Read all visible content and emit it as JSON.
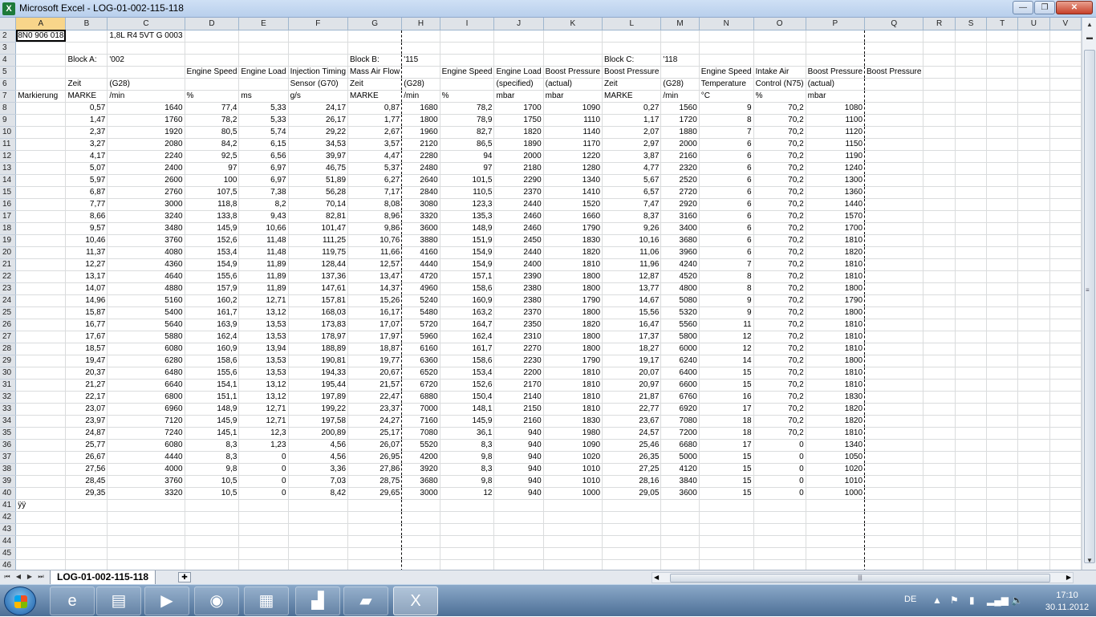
{
  "window": {
    "title": "Microsoft Excel - LOG-01-002-115-118",
    "app_icon": "X",
    "min_label": "—",
    "max_label": "❐",
    "close_label": "✕"
  },
  "columns": [
    "A",
    "B",
    "C",
    "D",
    "E",
    "F",
    "G",
    "H",
    "I",
    "J",
    "K",
    "L",
    "M",
    "N",
    "O",
    "P",
    "Q",
    "R",
    "S",
    "T",
    "U",
    "V"
  ],
  "rows": [
    {
      "n": "2",
      "c": [
        "8N0 906 018",
        "",
        "1,8L R4 5VT   G  0003",
        "",
        "",
        "",
        "",
        "",
        "",
        "",
        "",
        "",
        "",
        "",
        "",
        "",
        "",
        "",
        "",
        "",
        "",
        ""
      ]
    },
    {
      "n": "3",
      "c": [
        "",
        "",
        "",
        "",
        "",
        "",
        "",
        "",
        "",
        "",
        "",
        "",
        "",
        "",
        "",
        "",
        "",
        "",
        "",
        "",
        "",
        ""
      ]
    },
    {
      "n": "4",
      "c": [
        "",
        "Block A:",
        "'002",
        "",
        "",
        "",
        "Block B:",
        "'115",
        "",
        "",
        "",
        "Block C:",
        "'118",
        "",
        "",
        "",
        "",
        "",
        "",
        "",
        "",
        ""
      ]
    },
    {
      "n": "5",
      "c": [
        "",
        "",
        "",
        "Engine Speed",
        "Engine Load",
        "Injection Timing",
        "Mass Air Flow",
        "",
        "Engine Speed",
        "Engine Load",
        "Boost Pressure",
        "Boost Pressure",
        "",
        "Engine Speed",
        "Intake Air",
        "Boost Pressure",
        "Boost Pressure",
        "",
        "",
        "",
        "",
        ""
      ]
    },
    {
      "n": "6",
      "c": [
        "",
        "Zeit",
        "(G28)",
        "",
        "",
        "Sensor (G70)",
        "Zeit",
        "(G28)",
        "",
        "(specified)",
        "(actual)",
        "Zeit",
        "(G28)",
        "Temperature",
        "Control (N75)",
        "(actual)",
        "",
        "",
        "",
        "",
        "",
        ""
      ]
    },
    {
      "n": "7",
      "c": [
        "Markierung",
        "MARKE",
        "/min",
        "%",
        "ms",
        "g/s",
        "MARKE",
        "/min",
        "%",
        "mbar",
        "mbar",
        "MARKE",
        "/min",
        "°C",
        "%",
        "mbar",
        "",
        "",
        "",
        "",
        "",
        ""
      ]
    },
    {
      "n": "8",
      "c": [
        "",
        "0,57",
        "1640",
        "77,4",
        "5,33",
        "24,17",
        "0,87",
        "1680",
        "78,2",
        "1700",
        "1090",
        "0,27",
        "1560",
        "9",
        "70,2",
        "1080",
        "",
        "",
        "",
        "",
        "",
        ""
      ]
    },
    {
      "n": "9",
      "c": [
        "",
        "1,47",
        "1760",
        "78,2",
        "5,33",
        "26,17",
        "1,77",
        "1800",
        "78,9",
        "1750",
        "1110",
        "1,17",
        "1720",
        "8",
        "70,2",
        "1100",
        "",
        "",
        "",
        "",
        "",
        ""
      ]
    },
    {
      "n": "10",
      "c": [
        "",
        "2,37",
        "1920",
        "80,5",
        "5,74",
        "29,22",
        "2,67",
        "1960",
        "82,7",
        "1820",
        "1140",
        "2,07",
        "1880",
        "7",
        "70,2",
        "1120",
        "",
        "",
        "",
        "",
        "",
        ""
      ]
    },
    {
      "n": "11",
      "c": [
        "",
        "3,27",
        "2080",
        "84,2",
        "6,15",
        "34,53",
        "3,57",
        "2120",
        "86,5",
        "1890",
        "1170",
        "2,97",
        "2000",
        "6",
        "70,2",
        "1150",
        "",
        "",
        "",
        "",
        "",
        ""
      ]
    },
    {
      "n": "12",
      "c": [
        "",
        "4,17",
        "2240",
        "92,5",
        "6,56",
        "39,97",
        "4,47",
        "2280",
        "94",
        "2000",
        "1220",
        "3,87",
        "2160",
        "6",
        "70,2",
        "1190",
        "",
        "",
        "",
        "",
        "",
        ""
      ]
    },
    {
      "n": "13",
      "c": [
        "",
        "5,07",
        "2400",
        "97",
        "6,97",
        "46,75",
        "5,37",
        "2480",
        "97",
        "2180",
        "1280",
        "4,77",
        "2320",
        "6",
        "70,2",
        "1240",
        "",
        "",
        "",
        "",
        "",
        ""
      ]
    },
    {
      "n": "14",
      "c": [
        "",
        "5,97",
        "2600",
        "100",
        "6,97",
        "51,89",
        "6,27",
        "2640",
        "101,5",
        "2290",
        "1340",
        "5,67",
        "2520",
        "6",
        "70,2",
        "1300",
        "",
        "",
        "",
        "",
        "",
        ""
      ]
    },
    {
      "n": "15",
      "c": [
        "",
        "6,87",
        "2760",
        "107,5",
        "7,38",
        "56,28",
        "7,17",
        "2840",
        "110,5",
        "2370",
        "1410",
        "6,57",
        "2720",
        "6",
        "70,2",
        "1360",
        "",
        "",
        "",
        "",
        "",
        ""
      ]
    },
    {
      "n": "16",
      "c": [
        "",
        "7,77",
        "3000",
        "118,8",
        "8,2",
        "70,14",
        "8,08",
        "3080",
        "123,3",
        "2440",
        "1520",
        "7,47",
        "2920",
        "6",
        "70,2",
        "1440",
        "",
        "",
        "",
        "",
        "",
        ""
      ]
    },
    {
      "n": "17",
      "c": [
        "",
        "8,66",
        "3240",
        "133,8",
        "9,43",
        "82,81",
        "8,96",
        "3320",
        "135,3",
        "2460",
        "1660",
        "8,37",
        "3160",
        "6",
        "70,2",
        "1570",
        "",
        "",
        "",
        "",
        "",
        ""
      ]
    },
    {
      "n": "18",
      "c": [
        "",
        "9,57",
        "3480",
        "145,9",
        "10,66",
        "101,47",
        "9,86",
        "3600",
        "148,9",
        "2460",
        "1790",
        "9,26",
        "3400",
        "6",
        "70,2",
        "1700",
        "",
        "",
        "",
        "",
        "",
        ""
      ]
    },
    {
      "n": "19",
      "c": [
        "",
        "10,46",
        "3760",
        "152,6",
        "11,48",
        "111,25",
        "10,76",
        "3880",
        "151,9",
        "2450",
        "1830",
        "10,16",
        "3680",
        "6",
        "70,2",
        "1810",
        "",
        "",
        "",
        "",
        "",
        ""
      ]
    },
    {
      "n": "20",
      "c": [
        "",
        "11,37",
        "4080",
        "153,4",
        "11,48",
        "119,75",
        "11,66",
        "4160",
        "154,9",
        "2440",
        "1820",
        "11,06",
        "3960",
        "6",
        "70,2",
        "1820",
        "",
        "",
        "",
        "",
        "",
        ""
      ]
    },
    {
      "n": "21",
      "c": [
        "",
        "12,27",
        "4360",
        "154,9",
        "11,89",
        "128,44",
        "12,57",
        "4440",
        "154,9",
        "2400",
        "1810",
        "11,96",
        "4240",
        "7",
        "70,2",
        "1810",
        "",
        "",
        "",
        "",
        "",
        ""
      ]
    },
    {
      "n": "22",
      "c": [
        "",
        "13,17",
        "4640",
        "155,6",
        "11,89",
        "137,36",
        "13,47",
        "4720",
        "157,1",
        "2390",
        "1800",
        "12,87",
        "4520",
        "8",
        "70,2",
        "1810",
        "",
        "",
        "",
        "",
        "",
        ""
      ]
    },
    {
      "n": "23",
      "c": [
        "",
        "14,07",
        "4880",
        "157,9",
        "11,89",
        "147,61",
        "14,37",
        "4960",
        "158,6",
        "2380",
        "1800",
        "13,77",
        "4800",
        "8",
        "70,2",
        "1800",
        "",
        "",
        "",
        "",
        "",
        ""
      ]
    },
    {
      "n": "24",
      "c": [
        "",
        "14,96",
        "5160",
        "160,2",
        "12,71",
        "157,81",
        "15,26",
        "5240",
        "160,9",
        "2380",
        "1790",
        "14,67",
        "5080",
        "9",
        "70,2",
        "1790",
        "",
        "",
        "",
        "",
        "",
        ""
      ]
    },
    {
      "n": "25",
      "c": [
        "",
        "15,87",
        "5400",
        "161,7",
        "13,12",
        "168,03",
        "16,17",
        "5480",
        "163,2",
        "2370",
        "1800",
        "15,56",
        "5320",
        "9",
        "70,2",
        "1800",
        "",
        "",
        "",
        "",
        "",
        ""
      ]
    },
    {
      "n": "26",
      "c": [
        "",
        "16,77",
        "5640",
        "163,9",
        "13,53",
        "173,83",
        "17,07",
        "5720",
        "164,7",
        "2350",
        "1820",
        "16,47",
        "5560",
        "11",
        "70,2",
        "1810",
        "",
        "",
        "",
        "",
        "",
        ""
      ]
    },
    {
      "n": "27",
      "c": [
        "",
        "17,67",
        "5880",
        "162,4",
        "13,53",
        "178,97",
        "17,97",
        "5960",
        "162,4",
        "2310",
        "1800",
        "17,37",
        "5800",
        "12",
        "70,2",
        "1810",
        "",
        "",
        "",
        "",
        "",
        ""
      ]
    },
    {
      "n": "28",
      "c": [
        "",
        "18,57",
        "6080",
        "160,9",
        "13,94",
        "188,89",
        "18,87",
        "6160",
        "161,7",
        "2270",
        "1800",
        "18,27",
        "6000",
        "12",
        "70,2",
        "1810",
        "",
        "",
        "",
        "",
        "",
        ""
      ]
    },
    {
      "n": "29",
      "c": [
        "",
        "19,47",
        "6280",
        "158,6",
        "13,53",
        "190,81",
        "19,77",
        "6360",
        "158,6",
        "2230",
        "1790",
        "19,17",
        "6240",
        "14",
        "70,2",
        "1800",
        "",
        "",
        "",
        "",
        "",
        ""
      ]
    },
    {
      "n": "30",
      "c": [
        "",
        "20,37",
        "6480",
        "155,6",
        "13,53",
        "194,33",
        "20,67",
        "6520",
        "153,4",
        "2200",
        "1810",
        "20,07",
        "6400",
        "15",
        "70,2",
        "1810",
        "",
        "",
        "",
        "",
        "",
        ""
      ]
    },
    {
      "n": "31",
      "c": [
        "",
        "21,27",
        "6640",
        "154,1",
        "13,12",
        "195,44",
        "21,57",
        "6720",
        "152,6",
        "2170",
        "1810",
        "20,97",
        "6600",
        "15",
        "70,2",
        "1810",
        "",
        "",
        "",
        "",
        "",
        ""
      ]
    },
    {
      "n": "32",
      "c": [
        "",
        "22,17",
        "6800",
        "151,1",
        "13,12",
        "197,89",
        "22,47",
        "6880",
        "150,4",
        "2140",
        "1810",
        "21,87",
        "6760",
        "16",
        "70,2",
        "1830",
        "",
        "",
        "",
        "",
        "",
        ""
      ]
    },
    {
      "n": "33",
      "c": [
        "",
        "23,07",
        "6960",
        "148,9",
        "12,71",
        "199,22",
        "23,37",
        "7000",
        "148,1",
        "2150",
        "1810",
        "22,77",
        "6920",
        "17",
        "70,2",
        "1820",
        "",
        "",
        "",
        "",
        "",
        ""
      ]
    },
    {
      "n": "34",
      "c": [
        "",
        "23,97",
        "7120",
        "145,9",
        "12,71",
        "197,58",
        "24,27",
        "7160",
        "145,9",
        "2160",
        "1830",
        "23,67",
        "7080",
        "18",
        "70,2",
        "1820",
        "",
        "",
        "",
        "",
        "",
        ""
      ]
    },
    {
      "n": "35",
      "c": [
        "",
        "24,87",
        "7240",
        "145,1",
        "12,3",
        "200,89",
        "25,17",
        "7080",
        "36,1",
        "940",
        "1980",
        "24,57",
        "7200",
        "18",
        "70,2",
        "1810",
        "",
        "",
        "",
        "",
        "",
        ""
      ]
    },
    {
      "n": "36",
      "c": [
        "",
        "25,77",
        "6080",
        "8,3",
        "1,23",
        "4,56",
        "26,07",
        "5520",
        "8,3",
        "940",
        "1090",
        "25,46",
        "6680",
        "17",
        "0",
        "1340",
        "",
        "",
        "",
        "",
        "",
        ""
      ]
    },
    {
      "n": "37",
      "c": [
        "",
        "26,67",
        "4440",
        "8,3",
        "0",
        "4,56",
        "26,95",
        "4200",
        "9,8",
        "940",
        "1020",
        "26,35",
        "5000",
        "15",
        "0",
        "1050",
        "",
        "",
        "",
        "",
        "",
        ""
      ]
    },
    {
      "n": "38",
      "c": [
        "",
        "27,56",
        "4000",
        "9,8",
        "0",
        "3,36",
        "27,86",
        "3920",
        "8,3",
        "940",
        "1010",
        "27,25",
        "4120",
        "15",
        "0",
        "1020",
        "",
        "",
        "",
        "",
        "",
        ""
      ]
    },
    {
      "n": "39",
      "c": [
        "",
        "28,45",
        "3760",
        "10,5",
        "0",
        "7,03",
        "28,75",
        "3680",
        "9,8",
        "940",
        "1010",
        "28,16",
        "3840",
        "15",
        "0",
        "1010",
        "",
        "",
        "",
        "",
        "",
        ""
      ]
    },
    {
      "n": "40",
      "c": [
        "",
        "29,35",
        "3320",
        "10,5",
        "0",
        "8,42",
        "29,65",
        "3000",
        "12",
        "940",
        "1000",
        "29,05",
        "3600",
        "15",
        "0",
        "1000",
        "",
        "",
        "",
        "",
        "",
        ""
      ]
    },
    {
      "n": "41",
      "c": [
        "ÿÿ",
        "",
        "",
        "",
        "",
        "",
        "",
        "",
        "",
        "",
        "",
        "",
        "",
        "",
        "",
        "",
        "",
        "",
        "",
        "",
        "",
        ""
      ]
    },
    {
      "n": "42",
      "c": [
        "",
        "",
        "",
        "",
        "",
        "",
        "",
        "",
        "",
        "",
        "",
        "",
        "",
        "",
        "",
        "",
        "",
        "",
        "",
        "",
        "",
        ""
      ]
    },
    {
      "n": "43",
      "c": [
        "",
        "",
        "",
        "",
        "",
        "",
        "",
        "",
        "",
        "",
        "",
        "",
        "",
        "",
        "",
        "",
        "",
        "",
        "",
        "",
        "",
        ""
      ]
    },
    {
      "n": "44",
      "c": [
        "",
        "",
        "",
        "",
        "",
        "",
        "",
        "",
        "",
        "",
        "",
        "",
        "",
        "",
        "",
        "",
        "",
        "",
        "",
        "",
        "",
        ""
      ]
    },
    {
      "n": "45",
      "c": [
        "",
        "",
        "",
        "",
        "",
        "",
        "",
        "",
        "",
        "",
        "",
        "",
        "",
        "",
        "",
        "",
        "",
        "",
        "",
        "",
        "",
        ""
      ]
    },
    {
      "n": "46",
      "c": [
        "",
        "",
        "",
        "",
        "",
        "",
        "",
        "",
        "",
        "",
        "",
        "",
        "",
        "",
        "",
        "",
        "",
        "",
        "",
        "",
        "",
        ""
      ]
    }
  ],
  "sheet": {
    "tab_label": "LOG-01-002-115-118"
  },
  "taskbar": {
    "apps": [
      {
        "name": "internet-explorer",
        "glyph": "e"
      },
      {
        "name": "file-explorer",
        "glyph": "▤"
      },
      {
        "name": "media-player",
        "glyph": "▶"
      },
      {
        "name": "firefox",
        "glyph": "◉"
      },
      {
        "name": "winrar",
        "glyph": "▦"
      },
      {
        "name": "network-app",
        "glyph": "▟"
      },
      {
        "name": "notepad-app",
        "glyph": "▰"
      },
      {
        "name": "excel",
        "glyph": "X"
      }
    ],
    "lang": "DE",
    "time": "17:10",
    "date": "30.11.2012"
  }
}
